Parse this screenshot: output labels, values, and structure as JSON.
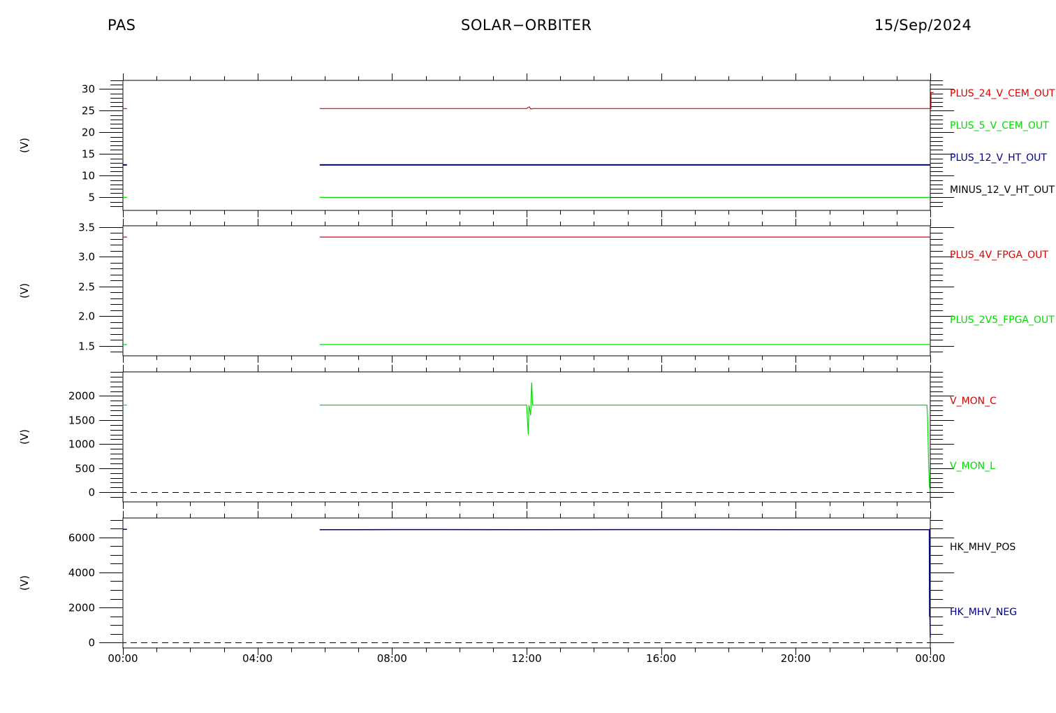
{
  "header": {
    "left": "PAS",
    "center": "SOLAR−ORBITER",
    "right": "15/Sep/2024"
  },
  "chart_data": [
    {
      "type": "line",
      "ylabel": "(V)",
      "ylim": [
        2,
        32
      ],
      "yticks": [
        5,
        10,
        15,
        20,
        25,
        30
      ],
      "ytick_labels": [
        "5",
        "10",
        "15",
        "20",
        "25",
        "30"
      ],
      "yminor": 1,
      "xlim": [
        0,
        24
      ],
      "series": [
        {
          "name": "PLUS_24_V_CEM_OUT",
          "color": "#dd0000",
          "x": [
            0,
            0.12,
            null,
            5.85,
            12.0,
            12.08,
            12.12,
            12.2,
            24.0,
            24.02,
            24.02,
            24.1
          ],
          "y": [
            25.5,
            25.5,
            null,
            25.5,
            25.5,
            25.9,
            25.4,
            25.5,
            25.5,
            25.5,
            29.2,
            29.2
          ]
        },
        {
          "name": "PLUS_5_V_CEM_OUT",
          "color": "#00dd00",
          "x": [
            0,
            0.12,
            null,
            5.85,
            24.0
          ],
          "y": [
            5.0,
            5.0,
            null,
            5.0,
            5.0
          ]
        },
        {
          "name": "PLUS_12_V_HT_OUT",
          "color": "#000080",
          "width": 2,
          "x": [
            0,
            0.12,
            null,
            5.85,
            24.0
          ],
          "y": [
            12.5,
            12.5,
            null,
            12.5,
            12.5
          ]
        },
        {
          "name": "MINUS_12_V_HT_OUT",
          "color": "#000000",
          "x": [],
          "y": []
        }
      ]
    },
    {
      "type": "line",
      "ylabel": "(V)",
      "ylim": [
        1.33,
        3.52
      ],
      "yticks": [
        1.5,
        2.0,
        2.5,
        3.0,
        3.5
      ],
      "ytick_labels": [
        "1.5",
        "2.0",
        "2.5",
        "3.0",
        "3.5"
      ],
      "yminor": 0.1,
      "xlim": [
        0,
        24
      ],
      "series": [
        {
          "name": "PLUS_4V_FPGA_OUT",
          "color": "#dd0000",
          "x": [
            0,
            0.12,
            null,
            5.85,
            24.0
          ],
          "y": [
            3.33,
            3.33,
            null,
            3.33,
            3.33
          ]
        },
        {
          "name": "PLUS_2V5_FPGA_OUT",
          "color": "#00dd00",
          "x": [
            0,
            0.12,
            null,
            5.85,
            24.0
          ],
          "y": [
            1.52,
            1.52,
            null,
            1.52,
            1.52
          ]
        }
      ]
    },
    {
      "type": "line",
      "ylabel": "(V)",
      "ylim": [
        -200,
        2500
      ],
      "yticks": [
        0,
        500,
        1000,
        1500,
        2000
      ],
      "ytick_labels": [
        "0",
        "500",
        "1000",
        "1500",
        "2000"
      ],
      "yminor": 100,
      "zero_line": true,
      "xlim": [
        0,
        24
      ],
      "series": [
        {
          "name": "V_MON_C",
          "color": "#dd0000",
          "x": [],
          "y": []
        },
        {
          "name": "V_MON_L",
          "color": "#00dd00",
          "x": [
            0,
            0.12,
            null,
            5.85,
            12.0,
            12.05,
            12.07,
            12.12,
            12.15,
            12.18,
            12.22,
            23.9,
            23.92,
            23.95,
            23.98,
            24.0
          ],
          "y": [
            1810,
            1810,
            null,
            1810,
            1810,
            1200,
            1810,
            1600,
            2280,
            1810,
            1810,
            1810,
            1560,
            600,
            100,
            30
          ]
        }
      ]
    },
    {
      "type": "line",
      "ylabel": "(V)",
      "ylim": [
        -300,
        7100
      ],
      "yticks": [
        0,
        2000,
        4000,
        6000
      ],
      "ytick_labels": [
        "0",
        "2000",
        "4000",
        "6000"
      ],
      "yminor": 500,
      "zero_line": true,
      "xlim": [
        0,
        24
      ],
      "xticks": [
        0,
        4,
        8,
        12,
        16,
        20,
        24
      ],
      "xtick_labels": [
        "00:00",
        "04:00",
        "08:00",
        "12:00",
        "16:00",
        "20:00",
        "00:00"
      ],
      "xminor": 1,
      "series": [
        {
          "name": "HK_MHV_POS",
          "color": "#000000",
          "x": [],
          "y": []
        },
        {
          "name": "HK_MHV_NEG",
          "color": "#000080",
          "width": 1.5,
          "x": [
            0,
            0.12,
            null,
            5.85,
            8.0,
            12.0,
            16.0,
            20.0,
            23.96,
            23.97,
            23.98,
            23.99,
            24.0
          ],
          "y": [
            6450,
            6450,
            null,
            6430,
            6440,
            6430,
            6440,
            6430,
            6430,
            6440,
            1500,
            1500,
            300
          ]
        }
      ]
    }
  ]
}
